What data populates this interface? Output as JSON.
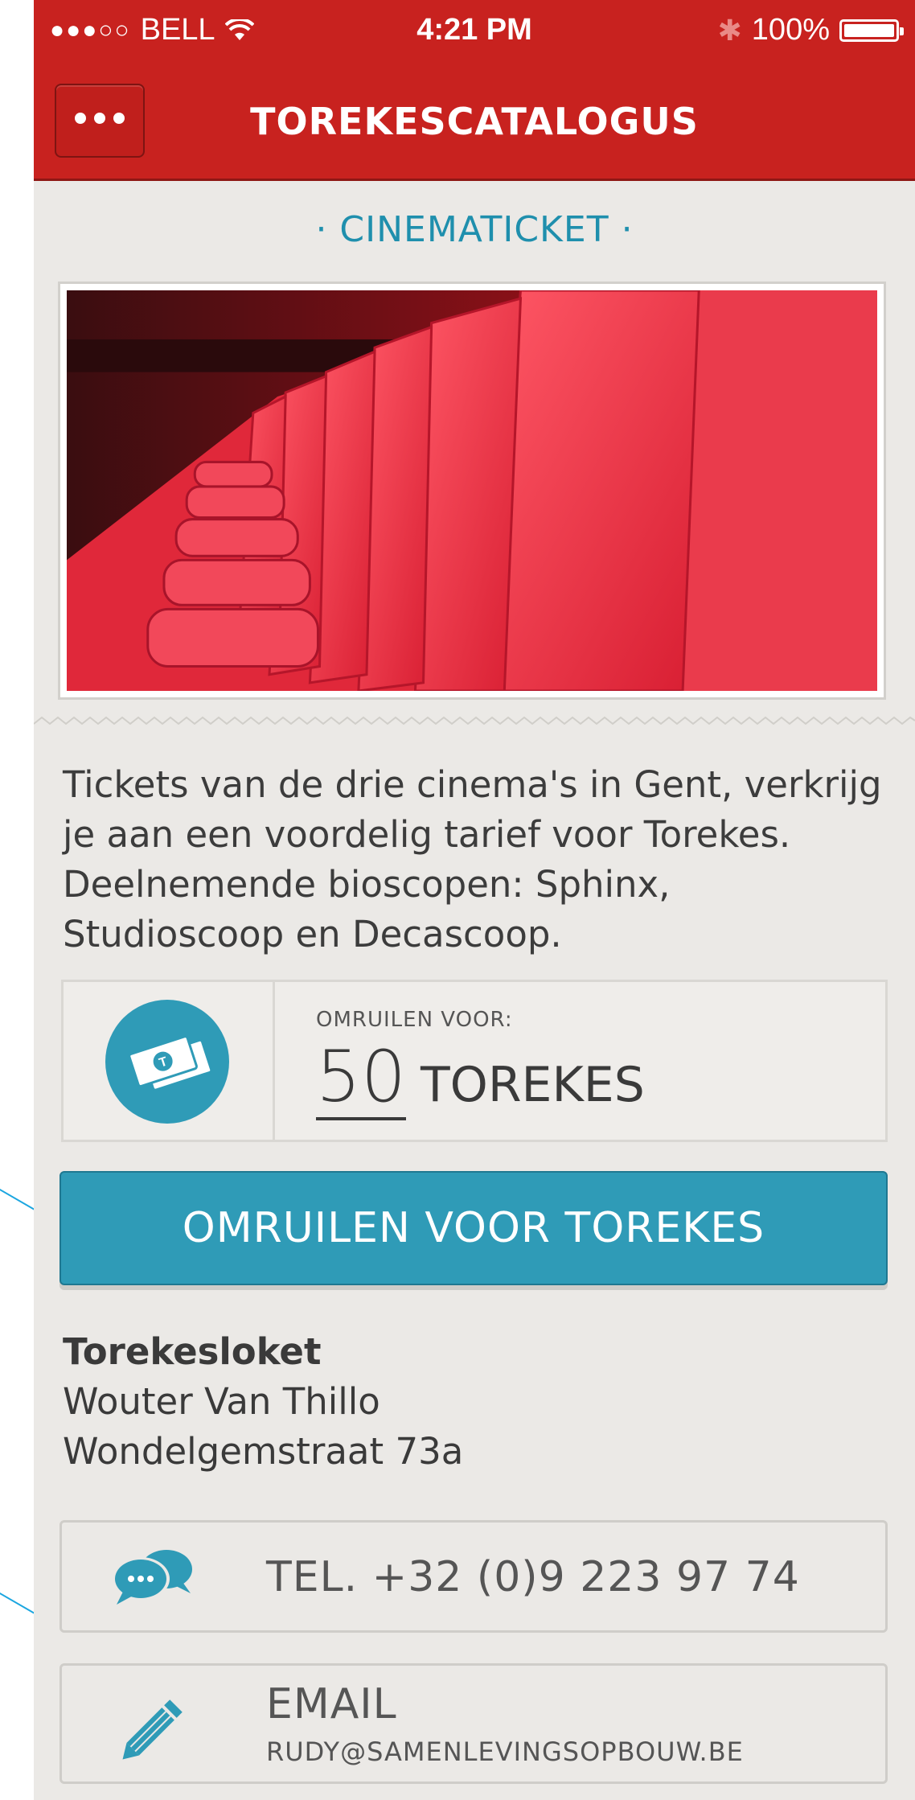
{
  "status_bar": {
    "carrier": "BELL",
    "time": "4:21 PM",
    "battery": "100%"
  },
  "nav": {
    "title": "TOREKESCATALOGUS",
    "menu_icon": "more-dots-icon"
  },
  "item": {
    "title": "· CINEMATICKET ·",
    "image_alt": "cinema seats",
    "description": "Tickets van de drie cinema's in Gent, verkrijg je aan een voordelig tarief voor Torekes. Deelnemende bioscopen: Sphinx, Studioscoop en Decascoop."
  },
  "price": {
    "label": "OMRUILEN VOOR:",
    "amount": "50",
    "unit": "TOREKES",
    "icon": "money-icon"
  },
  "cta": {
    "label": "OMRUILEN VOOR TOREKES"
  },
  "office": {
    "name": "Torekesloket",
    "person": "Wouter Van Thillo",
    "address": "Wondelgemstraat 73a"
  },
  "contact": {
    "phone_label": "TEL. +32 (0)9 223 97 74",
    "phone_icon": "chat-bubbles-icon",
    "email_label": "EMAIL",
    "email_address": "RUDY@SAMENLEVINGSOPBOUW.BE",
    "email_icon": "pencil-icon"
  },
  "colors": {
    "header_red": "#c8221f",
    "accent_teal": "#2f9bb7",
    "background": "#ebe9e6"
  }
}
